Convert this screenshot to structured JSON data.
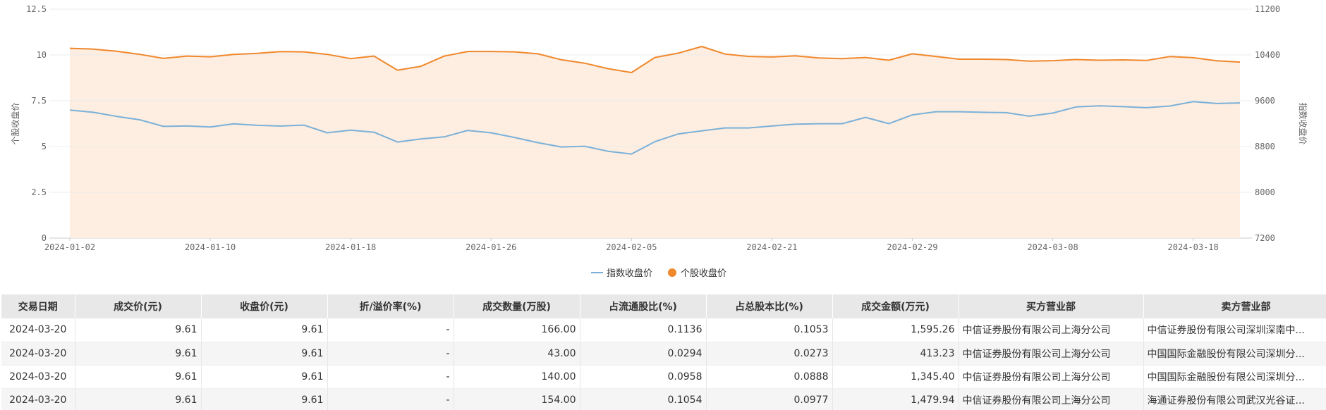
{
  "chart_data": {
    "type": "line",
    "x": [
      "2024-01-02",
      "2024-01-03",
      "2024-01-04",
      "2024-01-05",
      "2024-01-08",
      "2024-01-09",
      "2024-01-10",
      "2024-01-11",
      "2024-01-12",
      "2024-01-15",
      "2024-01-16",
      "2024-01-17",
      "2024-01-18",
      "2024-01-19",
      "2024-01-22",
      "2024-01-23",
      "2024-01-24",
      "2024-01-25",
      "2024-01-26",
      "2024-01-29",
      "2024-01-30",
      "2024-01-31",
      "2024-02-01",
      "2024-02-02",
      "2024-02-05",
      "2024-02-06",
      "2024-02-07",
      "2024-02-08",
      "2024-02-19",
      "2024-02-20",
      "2024-02-21",
      "2024-02-22",
      "2024-02-23",
      "2024-02-26",
      "2024-02-27",
      "2024-02-28",
      "2024-02-29",
      "2024-03-01",
      "2024-03-04",
      "2024-03-05",
      "2024-03-06",
      "2024-03-07",
      "2024-03-08",
      "2024-03-11",
      "2024-03-12",
      "2024-03-13",
      "2024-03-14",
      "2024-03-15",
      "2024-03-18",
      "2024-03-19",
      "2024-03-20"
    ],
    "x_ticks": [
      "2024-01-02",
      "2024-01-10",
      "2024-01-18",
      "2024-01-26",
      "2024-02-05",
      "2024-02-21",
      "2024-02-29",
      "2024-03-08",
      "2024-03-18"
    ],
    "series": [
      {
        "name": "指数收盘价",
        "axis": "right",
        "color": "#7bb0d8",
        "values": [
          9438,
          9398,
          9327,
          9267,
          9152,
          9160,
          9141,
          9197,
          9171,
          9158,
          9174,
          9040,
          9085,
          9050,
          8879,
          8932,
          8969,
          9082,
          9040,
          8959,
          8868,
          8793,
          8805,
          8718,
          8670,
          8885,
          9020,
          9075,
          9125,
          9125,
          9158,
          9190,
          9199,
          9199,
          9309,
          9200,
          9352,
          9408,
          9408,
          9398,
          9392,
          9330,
          9385,
          9492,
          9511,
          9497,
          9478,
          9508,
          9584,
          9552,
          9562
        ]
      },
      {
        "name": "个股收盘价",
        "axis": "left",
        "color": "#f0882d",
        "values": [
          10.36,
          10.32,
          10.2,
          10.03,
          9.81,
          9.94,
          9.9,
          10.03,
          10.09,
          10.18,
          10.17,
          10.03,
          9.8,
          9.94,
          9.17,
          9.38,
          9.94,
          10.19,
          10.19,
          10.17,
          10.06,
          9.74,
          9.55,
          9.25,
          9.04,
          9.86,
          10.1,
          10.46,
          10.05,
          9.92,
          9.89,
          9.95,
          9.84,
          9.8,
          9.86,
          9.71,
          10.06,
          9.92,
          9.77,
          9.77,
          9.75,
          9.66,
          9.69,
          9.75,
          9.71,
          9.73,
          9.7,
          9.91,
          9.85,
          9.68,
          9.61
        ]
      }
    ],
    "ylabel": "个股收盘价",
    "ylim": [
      0,
      12.5
    ],
    "yticks": [
      "0",
      "2.5",
      "5",
      "7.5",
      "10",
      "12.5"
    ],
    "y2label": "指数收盘价",
    "y2lim": [
      7200,
      11200
    ],
    "y2ticks": [
      "7200",
      "8000",
      "8800",
      "9600",
      "10400",
      "11200"
    ],
    "legend_position": "bottom",
    "area_fill_color": "#fdeee1",
    "grid": true
  },
  "legend": [
    {
      "label": "指数收盘价",
      "marker": "line",
      "color": "#7bb0d8"
    },
    {
      "label": "个股收盘价",
      "marker": "circle",
      "color": "#f0882d"
    }
  ],
  "table": {
    "headers": [
      "交易日期",
      "成交价(元)",
      "收盘价(元)",
      "折/溢价率(%)",
      "成交数量(万股)",
      "占流通股比(%)",
      "占总股本比(%)",
      "成交金额(万元)",
      "买方营业部",
      "卖方营业部"
    ],
    "rows": [
      [
        "2024-03-20",
        "9.61",
        "9.61",
        "-",
        "166.00",
        "0.1136",
        "0.1053",
        "1,595.26",
        "中信证券股份有限公司上海分公司",
        "中信证券股份有限公司深圳深南中..."
      ],
      [
        "2024-03-20",
        "9.61",
        "9.61",
        "-",
        "43.00",
        "0.0294",
        "0.0273",
        "413.23",
        "中信证券股份有限公司上海分公司",
        "中国国际金融股份有限公司深圳分..."
      ],
      [
        "2024-03-20",
        "9.61",
        "9.61",
        "-",
        "140.00",
        "0.0958",
        "0.0888",
        "1,345.40",
        "中信证券股份有限公司上海分公司",
        "中国国际金融股份有限公司深圳分..."
      ],
      [
        "2024-03-20",
        "9.61",
        "9.61",
        "-",
        "154.00",
        "0.1054",
        "0.0977",
        "1,479.94",
        "中信证券股份有限公司上海分公司",
        "海通证券股份有限公司武汉光谷证..."
      ]
    ]
  }
}
